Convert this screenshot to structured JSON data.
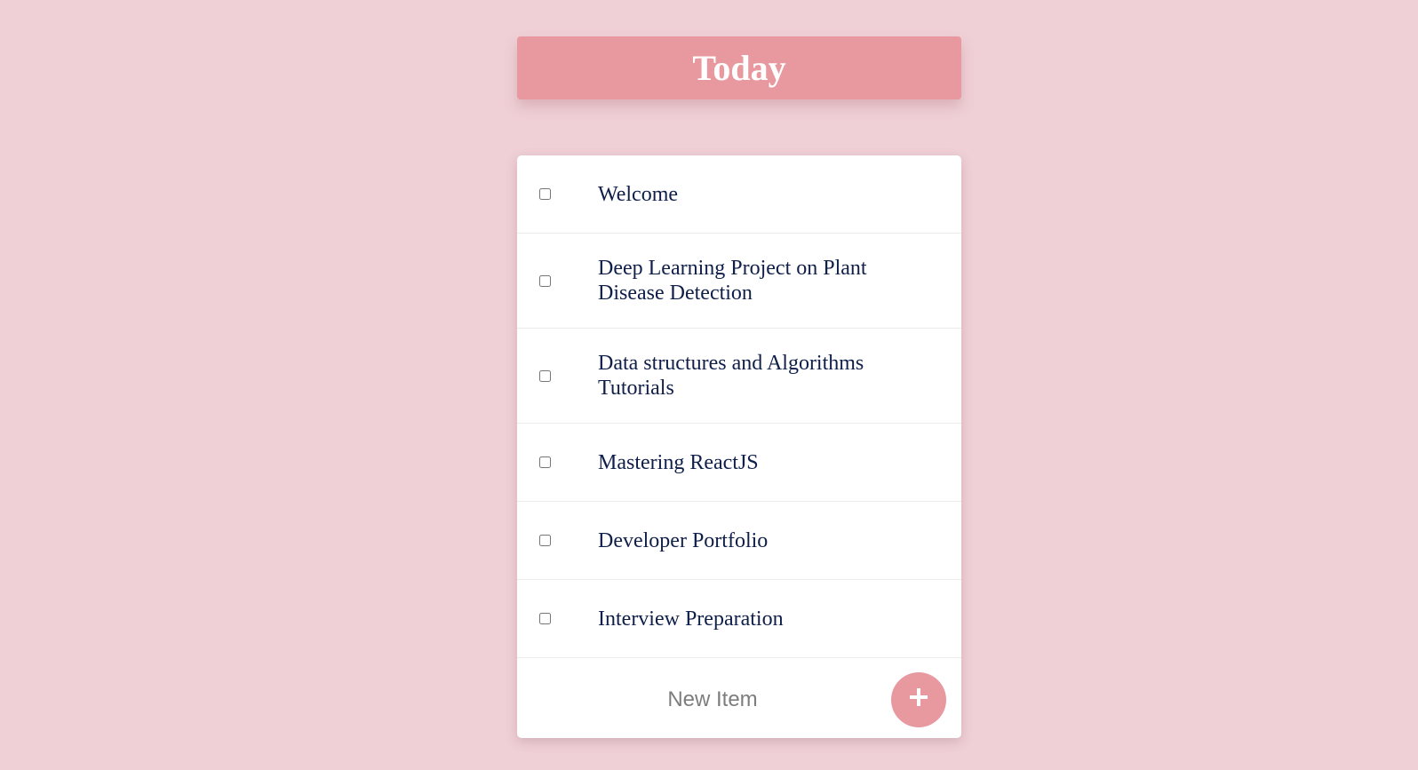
{
  "heading": {
    "title": "Today"
  },
  "todo": {
    "items": [
      {
        "label": "Welcome",
        "checked": false
      },
      {
        "label": "Deep Learning Project on Plant Disease Detection",
        "checked": false
      },
      {
        "label": "Data structures and Algorithms Tutorials",
        "checked": false
      },
      {
        "label": "Mastering ReactJS",
        "checked": false
      },
      {
        "label": "Developer Portfolio",
        "checked": false
      },
      {
        "label": "Interview Preparation",
        "checked": false
      }
    ],
    "new_item": {
      "placeholder": "New Item",
      "value": "",
      "add_icon": "plus-icon"
    }
  },
  "colors": {
    "background": "#efd0d6",
    "accent": "#e8989f",
    "card": "#ffffff",
    "text": "#0f1f4a"
  }
}
